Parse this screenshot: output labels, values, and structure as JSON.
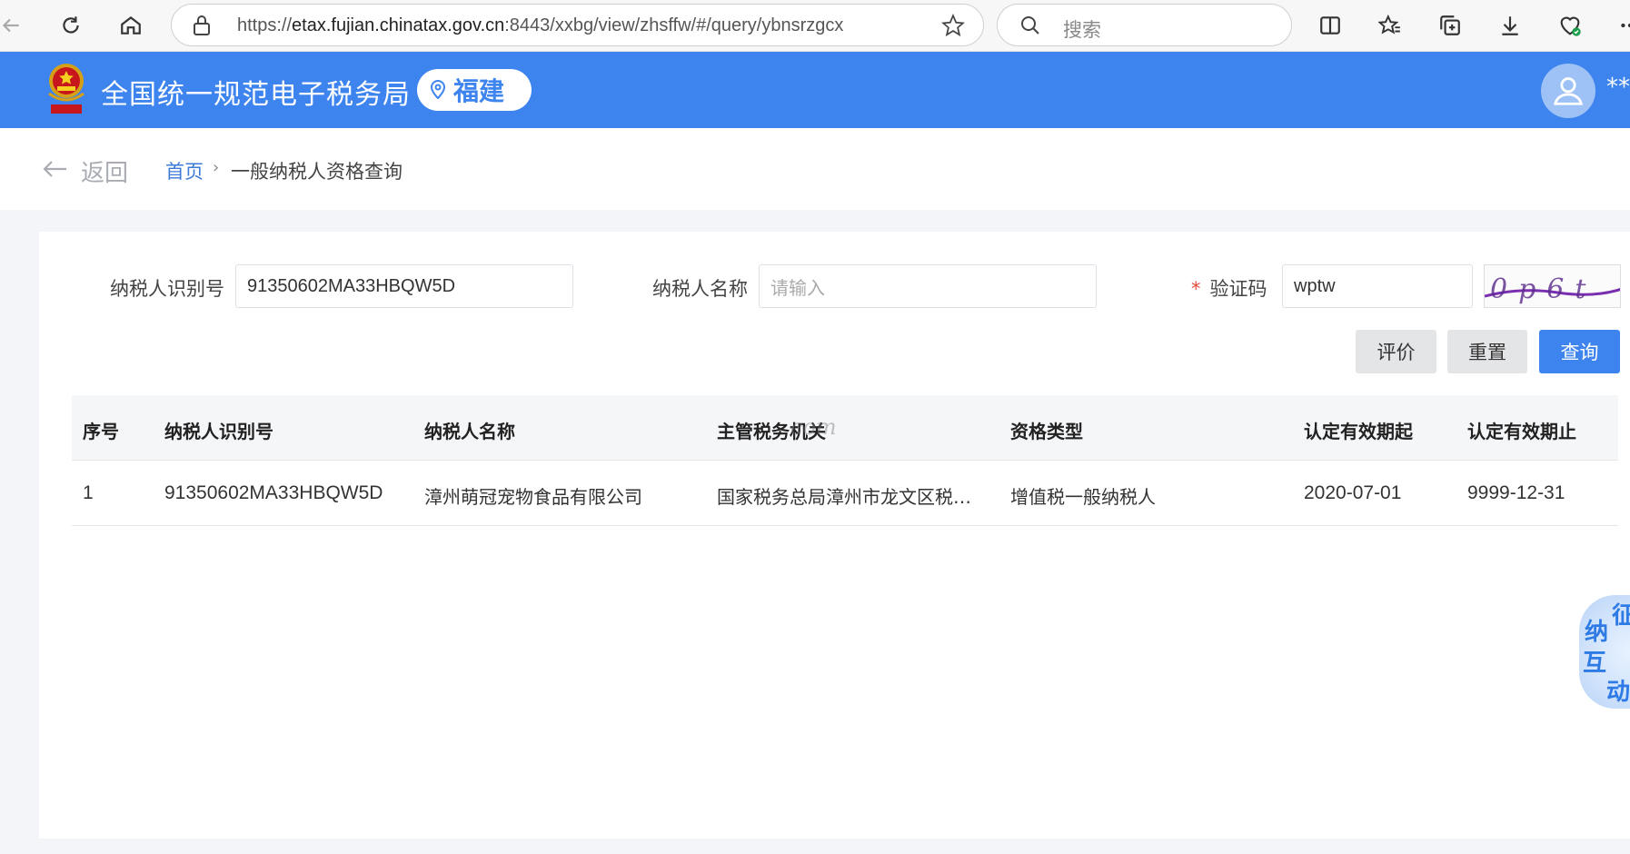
{
  "browser": {
    "url_prefix": "https://",
    "url_host": "etax.fujian.chinatax.gov.cn",
    "url_rest": ":8443/xxbg/view/zhsffw/#/query/ybnsrzgcx",
    "search_placeholder": "搜索"
  },
  "header": {
    "title": "全国统一规范电子税务局",
    "region": "福建",
    "user": "**"
  },
  "breadcrumb": {
    "back": "返回",
    "home": "首页",
    "separator": "›",
    "current": "一般纳税人资格查询"
  },
  "form": {
    "taxpayer_id_label": "纳税人识别号",
    "taxpayer_id_value": "91350602MA33HBQW5D",
    "taxpayer_name_label": "纳税人名称",
    "taxpayer_name_placeholder": "请输入",
    "captcha_required_mark": "*",
    "captcha_label": "验证码",
    "captcha_value": "wptw",
    "captcha_image_text": "0p6t"
  },
  "buttons": {
    "evaluate": "评价",
    "reset": "重置",
    "query": "查询"
  },
  "table": {
    "columns": [
      "序号",
      "纳税人识别号",
      "纳税人名称",
      "主管税务机关",
      "资格类型",
      "认定有效期起",
      "认定有效期止"
    ],
    "rows": [
      [
        "1",
        "91350602MA33HBQW5D",
        "漳州萌冠宠物食品有限公司",
        "国家税务总局漳州市龙文区税…",
        "增值税一般纳税人",
        "2020-07-01",
        "9999-12-31"
      ]
    ]
  },
  "watermark": "com",
  "float_widget": {
    "chars": [
      "纳",
      "互",
      "动",
      "征"
    ]
  },
  "colors": {
    "header_blue": "#3d84ee",
    "link_blue": "#3d7bd9",
    "required_red": "#e74c3c"
  }
}
